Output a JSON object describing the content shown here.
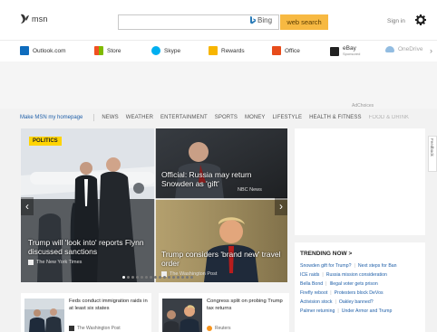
{
  "header": {
    "logo_text": "msn",
    "search": {
      "value": "",
      "placeholder": ""
    },
    "bing_label": "Bing",
    "search_button": "web search",
    "signin_label": "Sign in"
  },
  "linkbar": {
    "items": [
      {
        "label": "Outlook.com",
        "icon": "outlook-icon",
        "color": "#0f6cbd"
      },
      {
        "label": "Store",
        "icon": "store-icon",
        "color": "#f25022"
      },
      {
        "label": "Skype",
        "icon": "skype-icon",
        "color": "#00aff0"
      },
      {
        "label": "Rewards",
        "icon": "rewards-icon",
        "color": "#f7b500"
      },
      {
        "label": "Office",
        "icon": "office-icon",
        "color": "#e74c1b"
      },
      {
        "label": "eBay",
        "sublabel": "Sponsored",
        "icon": "ebay-icon",
        "color": "#222222"
      },
      {
        "label": "OneDrive",
        "icon": "onedrive-icon",
        "color": "#0f6cbd"
      }
    ],
    "next_glyph": "›"
  },
  "ad_label": "AdChoices",
  "nav": {
    "my_homepage": "Make MSN my homepage",
    "items": [
      "NEWS",
      "WEATHER",
      "ENTERTAINMENT",
      "SPORTS",
      "MONEY",
      "LIFESTYLE",
      "HEALTH & FITNESS",
      "FOOD & DRINK"
    ]
  },
  "hero": {
    "badge": "POLITICS",
    "stories": [
      {
        "headline": "Trump will 'look into' reports Flynn discussed sanctions",
        "source": "The New York Times"
      },
      {
        "headline": "Official: Russia may return Snowden as 'gift'",
        "source": "NBC News"
      },
      {
        "headline": "Trump considers 'brand new' travel order",
        "source": "The Washington Post"
      }
    ],
    "prev_glyph": "‹",
    "next_glyph": "›",
    "slide_count": 16,
    "active_slide": 0
  },
  "feedback_label": "Feedback",
  "trending": {
    "title": "TRENDING NOW >",
    "rows": [
      [
        "Snowden gift for Trump?",
        "Next steps for Ban"
      ],
      [
        "ICE raids",
        "Russia mission consideration"
      ],
      [
        "Bella Bond",
        "Illegal voter gets prison"
      ],
      [
        "Firefly reboot",
        "Protesters block DeVos"
      ],
      [
        "Activision stock",
        "Oakley banned?"
      ],
      [
        "Palmer returning",
        "Under Armor and Trump"
      ]
    ]
  },
  "cards": [
    {
      "headline": "Feds conduct immigration raids in at least six states",
      "source": "The Washington Post"
    },
    {
      "headline": "Congress split on probing Trump tax returns",
      "source": "Reuters"
    }
  ],
  "colors": {
    "accent_yellow": "#f7b942",
    "link_blue": "#1f5fa8",
    "badge_yellow": "#ffd400"
  }
}
